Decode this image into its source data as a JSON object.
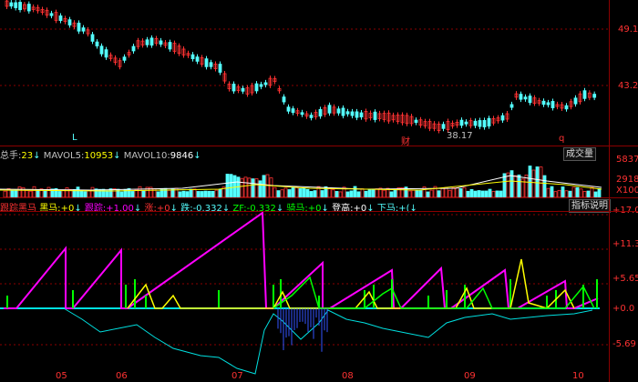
{
  "colors": {
    "up": "#ff3232",
    "down": "#54ffff",
    "grid": "#8b0000",
    "magenta": "#ff00ff",
    "yellow": "#ffff00",
    "green": "#00ff00",
    "cyan": "#00e0e0",
    "white": "#ffffff",
    "orange": "#ff9900"
  },
  "price_axis": {
    "l1": "49.17",
    "l2": "43.22"
  },
  "price_annotations": {
    "low_value": "38.17",
    "cai": "财",
    "q": "q",
    "l": "L"
  },
  "volume": {
    "zongshou_label": "总手:",
    "zongshou_value": "23",
    "mavol5_label": "MAVOL5:",
    "mavol5_value": "10953",
    "mavol10_label": "MAVOL10:",
    "mavol10_value": "9846",
    "button": "成交量",
    "axis": {
      "l1": "5837",
      "l2": "2918",
      "l3": "X100"
    }
  },
  "indicator": {
    "title": "跟踪黑马",
    "items": [
      {
        "label": "黑马:",
        "value": "+0",
        "color": "#ffff00"
      },
      {
        "label": "跟踪:",
        "value": "+1.00",
        "color": "#ff00ff"
      },
      {
        "label": "涨:",
        "value": "+0",
        "color": "#ff3232"
      },
      {
        "label": "跌:",
        "value": "-0.332",
        "color": "#54ffff"
      },
      {
        "label": "ZF:",
        "value": "-0.332",
        "color": "#00ff00"
      },
      {
        "label": "骑马:",
        "value": "+0",
        "color": "#00ff00"
      },
      {
        "label": "登高:",
        "value": "+0",
        "color": "#ffffff"
      },
      {
        "label": "下马:",
        "value": "+(",
        "color": "#54ffff"
      }
    ],
    "button": "指标说明",
    "axis": {
      "l1": "+17.0",
      "l2": "+11.3",
      "l3": "+5.65",
      "l4": "+0.0",
      "l5": "-5.69"
    }
  },
  "time_axis": [
    "05",
    "06",
    "07",
    "08",
    "09",
    "10"
  ]
}
